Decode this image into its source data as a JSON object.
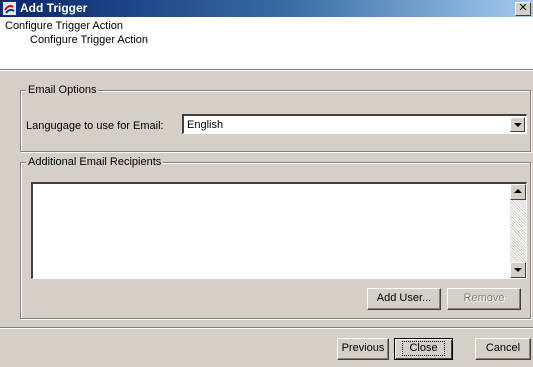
{
  "window": {
    "title": "Add Trigger",
    "close_glyph": "✕"
  },
  "header": {
    "title": "Configure Trigger Action",
    "subtitle": "Configure Trigger Action"
  },
  "email_options": {
    "legend": "Email Options",
    "language_label": "Langugage to use for Email:",
    "language_value": "English"
  },
  "recipients": {
    "legend": "Additional Email Recipients",
    "value": "",
    "add_user_label": "Add User...",
    "remove_label": "Remove"
  },
  "footer": {
    "previous_label": "Previous",
    "close_label": "Close",
    "cancel_label": "Cancel"
  }
}
